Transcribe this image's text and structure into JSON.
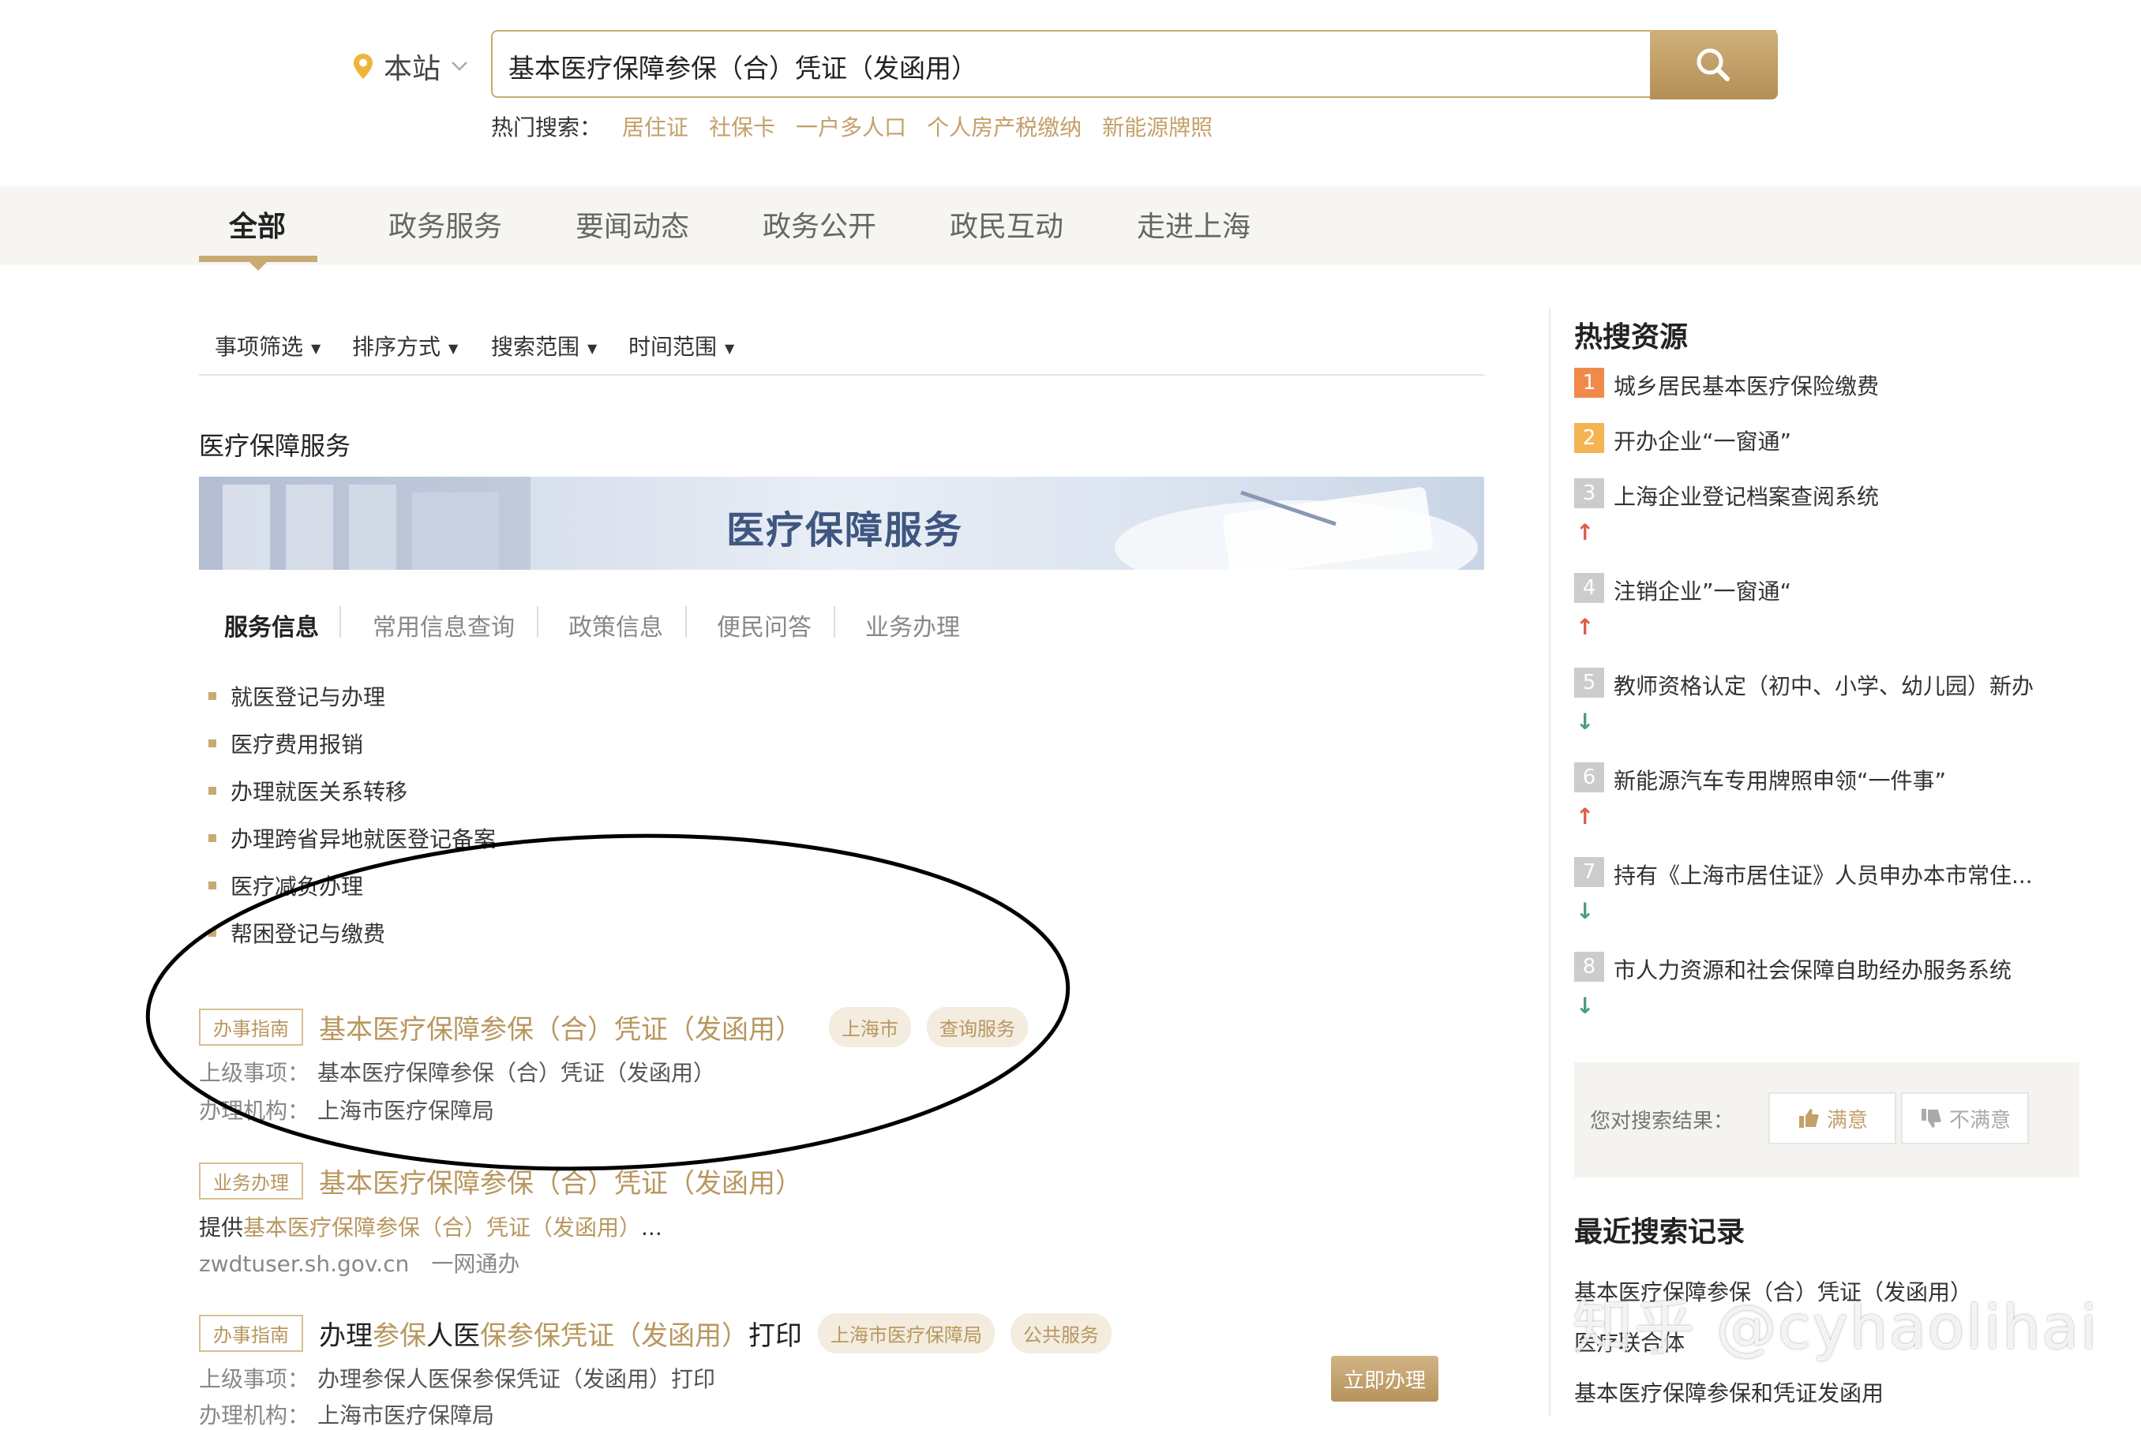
{
  "search": {
    "scope": "本站",
    "query": "基本医疗保障参保（合）凭证（发函用）",
    "hot_label": "热门搜索：",
    "hot_terms": [
      "居住证",
      "社保卡",
      "一户多人口",
      "个人房产税缴纳",
      "新能源牌照"
    ]
  },
  "nav": {
    "tabs": [
      "全部",
      "政务服务",
      "要闻动态",
      "政务公开",
      "政民互动",
      "走进上海"
    ],
    "active": "全部"
  },
  "filters": [
    "事项筛选",
    "排序方式",
    "搜索范围",
    "时间范围"
  ],
  "section": {
    "title": "医疗保障服务",
    "banner_text": "医疗保障服务",
    "tabs": [
      "服务信息",
      "常用信息查询",
      "政策信息",
      "便民问答",
      "业务办理"
    ],
    "items": [
      "就医登记与办理",
      "医疗费用报销",
      "办理就医关系转移",
      "办理跨省异地就医登记备案",
      "医疗减负办理",
      "帮困登记与缴费"
    ]
  },
  "results": [
    {
      "tag": "办事指南",
      "title": "基本医疗保障参保（合）凭证（发函用）",
      "pills": [
        "上海市",
        "查询服务"
      ],
      "parent_label": "上级事项：",
      "parent": "基本医疗保障参保（合）凭证（发函用）",
      "org_label": "办理机构：",
      "org": "上海市医疗保障局"
    },
    {
      "tag": "业务办理",
      "title": "基本医疗保障参保（合）凭证（发函用）",
      "desc_prefix": "提供",
      "desc_hl": "基本医疗保障参保（合）凭证（发函用）",
      "desc_suffix": "...",
      "url": "zwdtuser.sh.gov.cn",
      "source": "一网通办"
    },
    {
      "tag": "办事指南",
      "title_parts": [
        "办理",
        "参保",
        "人医",
        "保参保凭证（发函用）",
        "打印"
      ],
      "pills": [
        "上海市医疗保障局",
        "公共服务"
      ],
      "parent_label": "上级事项：",
      "parent": "办理参保人医保参保凭证（发函用）打印",
      "org_label": "办理机构：",
      "org": "上海市医疗保障局",
      "action": "立即办理"
    }
  ],
  "sidebar": {
    "hot_title": "热搜资源",
    "hot_items": [
      {
        "rank": "1",
        "text": "城乡居民基本医疗保险缴费",
        "trend": "",
        "color": "#f08a4b"
      },
      {
        "rank": "2",
        "text": "开办企业“一窗通”",
        "trend": "",
        "color": "#f5b454"
      },
      {
        "rank": "3",
        "text": "上海企业登记档案查阅系统",
        "trend": "up",
        "color": "#cccccc"
      },
      {
        "rank": "4",
        "text": "注销企业”一窗通“",
        "trend": "up",
        "color": "#cccccc"
      },
      {
        "rank": "5",
        "text": "教师资格认定（初中、小学、幼儿园）新办",
        "trend": "down",
        "color": "#cccccc"
      },
      {
        "rank": "6",
        "text": "新能源汽车专用牌照申领“一件事”",
        "trend": "up",
        "color": "#cccccc"
      },
      {
        "rank": "7",
        "text": "持有《上海市居住证》人员申办本市常住...",
        "trend": "down",
        "color": "#cccccc"
      },
      {
        "rank": "8",
        "text": "市人力资源和社会保障自助经办服务系统",
        "trend": "down",
        "color": "#cccccc"
      }
    ],
    "feedback_label": "您对搜索结果：",
    "satisfied": "满意",
    "unsatisfied": "不满意",
    "recent_title": "最近搜索记录",
    "recent": [
      "基本医疗保障参保（合）凭证（发函用）",
      "医疗联合体",
      "基本医疗保障参保和凭证发函用"
    ]
  },
  "watermark": "知乎 @cyhaolihai",
  "colors": {
    "accent": "#c8aa72",
    "accent_text": "#b8975f",
    "up": "#e05a4a",
    "down": "#4c9a86"
  }
}
